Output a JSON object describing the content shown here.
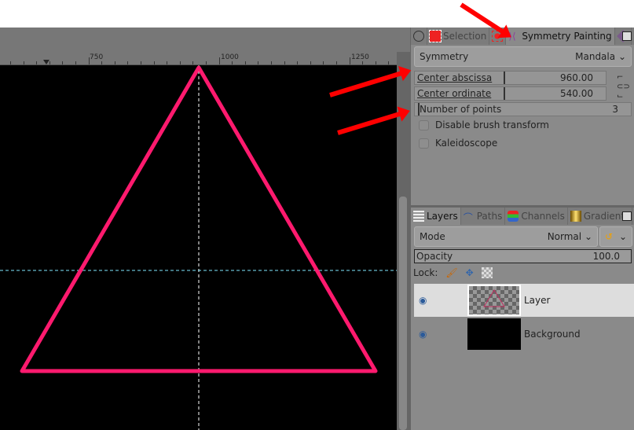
{
  "ruler": {
    "labels": [
      "750",
      "1000",
      "1250"
    ]
  },
  "dock_tabs": {
    "selection": "Selection",
    "symmetry": "Symmetry Painting"
  },
  "symmetry": {
    "label": "Symmetry",
    "value": "Mandala",
    "center_abscissa": {
      "label": "Center abscissa",
      "value": "960.00"
    },
    "center_ordinate": {
      "label": "Center ordinate",
      "value": "540.00"
    },
    "number_of_points": {
      "label": "Number of points",
      "value": "3"
    },
    "disable_brush_transform": "Disable brush transform",
    "kaleidoscope": "Kaleidoscope"
  },
  "layers_tabs": {
    "layers": "Layers",
    "paths": "Paths",
    "channels": "Channels",
    "gradients": "Gradients"
  },
  "layers": {
    "mode_label": "Mode",
    "mode_value": "Normal",
    "opacity_label": "Opacity",
    "opacity_value": "100.0",
    "lock_label": "Lock:",
    "items": [
      {
        "name": "Layer"
      },
      {
        "name": "Background"
      }
    ]
  },
  "colors": {
    "stroke": "#ff1a6e",
    "guide": "#7fe8ff",
    "annotation": "#ff0000"
  }
}
